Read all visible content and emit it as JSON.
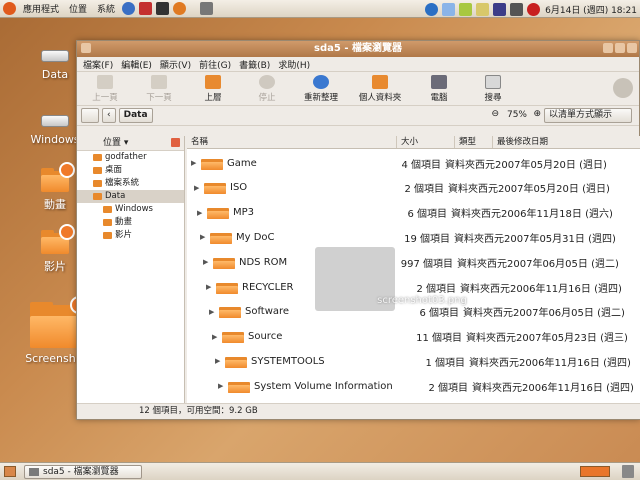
{
  "top_panel": {
    "menus": [
      "應用程式",
      "位置",
      "系統"
    ],
    "clock": "6月14日 (週四) 18:21"
  },
  "desktop": {
    "icons": [
      {
        "label": "Data"
      },
      {
        "label": "Windows"
      },
      {
        "label": "動畫"
      },
      {
        "label": "影片"
      },
      {
        "label": "Screenshot"
      }
    ]
  },
  "window": {
    "title": "sda5 - 檔案瀏覽器",
    "menubar": [
      "檔案(F)",
      "編輯(E)",
      "顯示(V)",
      "前往(G)",
      "書籤(B)",
      "求助(H)"
    ],
    "toolbar": [
      {
        "label": "上一頁",
        "enabled": false
      },
      {
        "label": "下一頁",
        "enabled": false
      },
      {
        "label": "上層",
        "enabled": true
      },
      {
        "label": "停止",
        "enabled": false
      },
      {
        "label": "重新整理",
        "enabled": true
      },
      {
        "label": "個人資料夾",
        "enabled": true
      },
      {
        "label": "電腦",
        "enabled": true
      },
      {
        "label": "搜尋",
        "enabled": true
      }
    ],
    "location": {
      "path_button": "Data",
      "zoom": "75%",
      "view_mode": "以清單方式顯示"
    },
    "side_pane": {
      "title": "位置",
      "items": [
        {
          "label": "godfather",
          "selected": false
        },
        {
          "label": "桌面",
          "selected": false
        },
        {
          "label": "檔案系統",
          "selected": false
        },
        {
          "label": "Data",
          "selected": true
        },
        {
          "label": "Windows",
          "selected": false
        },
        {
          "label": "動畫",
          "selected": false
        },
        {
          "label": "影片",
          "selected": false
        }
      ]
    },
    "columns": [
      "名稱",
      "大小",
      "類型",
      "最後修改日期"
    ],
    "files": [
      {
        "name": "Game",
        "size": "4 個項目",
        "type": "資料夾",
        "date": "西元2007年05月20日 (週日)"
      },
      {
        "name": "ISO",
        "size": "2 個項目",
        "type": "資料夾",
        "date": "西元2007年05月20日 (週日)"
      },
      {
        "name": "MP3",
        "size": "6 個項目",
        "type": "資料夾",
        "date": "西元2006年11月18日 (週六)"
      },
      {
        "name": "My DoC",
        "size": "19 個項目",
        "type": "資料夾",
        "date": "西元2007年05月31日 (週四)"
      },
      {
        "name": "NDS ROM",
        "size": "997 個項目",
        "type": "資料夾",
        "date": "西元2007年06月05日 (週二)"
      },
      {
        "name": "RECYCLER",
        "size": "2 個項目",
        "type": "資料夾",
        "date": "西元2006年11月16日 (週四)"
      },
      {
        "name": "Software",
        "size": "6 個項目",
        "type": "資料夾",
        "date": "西元2007年06月05日 (週二)"
      },
      {
        "name": "Source",
        "size": "11 個項目",
        "type": "資料夾",
        "date": "西元2007年05月23日 (週三)"
      },
      {
        "name": "SYSTEMTOOLS",
        "size": "1 個項目",
        "type": "資料夾",
        "date": "西元2006年11月16日 (週四)"
      },
      {
        "name": "System Volume Information",
        "size": "2 個項目",
        "type": "資料夾",
        "date": "西元2006年11月16日 (週四)"
      }
    ],
    "drag_ghost_label": "screenshot03.png",
    "status": "12 個項目，可用空間：9.2 GB"
  },
  "bottom_panel": {
    "task_label": "sda5 - 檔案瀏覽器"
  }
}
